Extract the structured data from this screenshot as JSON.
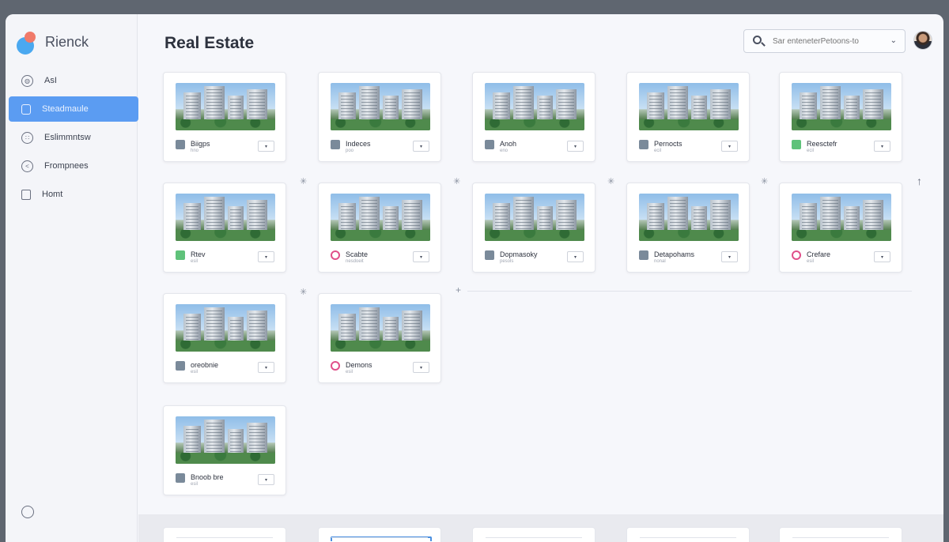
{
  "app": {
    "name": "Rienck"
  },
  "sidebar": {
    "items": [
      {
        "label": "AsI",
        "icon": "globe-icon"
      },
      {
        "label": "Steadmaule",
        "icon": "document-icon",
        "active": true
      },
      {
        "label": "Eslimmntsw",
        "icon": "settings-icon"
      },
      {
        "label": "Frompnees",
        "icon": "clock-icon"
      },
      {
        "label": "Homt",
        "icon": "calendar-icon"
      }
    ],
    "bottom_icon": "help-icon"
  },
  "header": {
    "title": "Real Estate",
    "search": {
      "placeholder": "Sar enteneterPetoons-to",
      "icon": "search-icon"
    }
  },
  "listings": [
    {
      "title": "Biigps",
      "subtitle": "hno"
    },
    {
      "title": "Indeces",
      "subtitle": "poo"
    },
    {
      "title": "Anoh",
      "subtitle": "eno"
    },
    {
      "title": "Pernocts",
      "subtitle": "ecil"
    },
    {
      "title": "Reesctefr",
      "subtitle": "ecil"
    },
    {
      "title": "Rtev",
      "subtitle": "esil"
    },
    {
      "title": "Scabte",
      "subtitle": "nesdoeit"
    },
    {
      "title": "Dopmasoky",
      "subtitle": "pesols"
    },
    {
      "title": "Detapohams",
      "subtitle": "nonal"
    },
    {
      "title": "Crefare",
      "subtitle": "esil"
    },
    {
      "title": "oreobnie",
      "subtitle": "esil"
    },
    {
      "title": "Demons",
      "subtitle": "esil"
    },
    {
      "title": "Bnoob bre",
      "subtitle": "esil"
    }
  ],
  "card_button_label": "▾",
  "colors": {
    "accent": "#5b9cf2",
    "background": "#f6f7fb",
    "ring_badge": "#e0508a",
    "green_badge": "#5fc27a"
  }
}
